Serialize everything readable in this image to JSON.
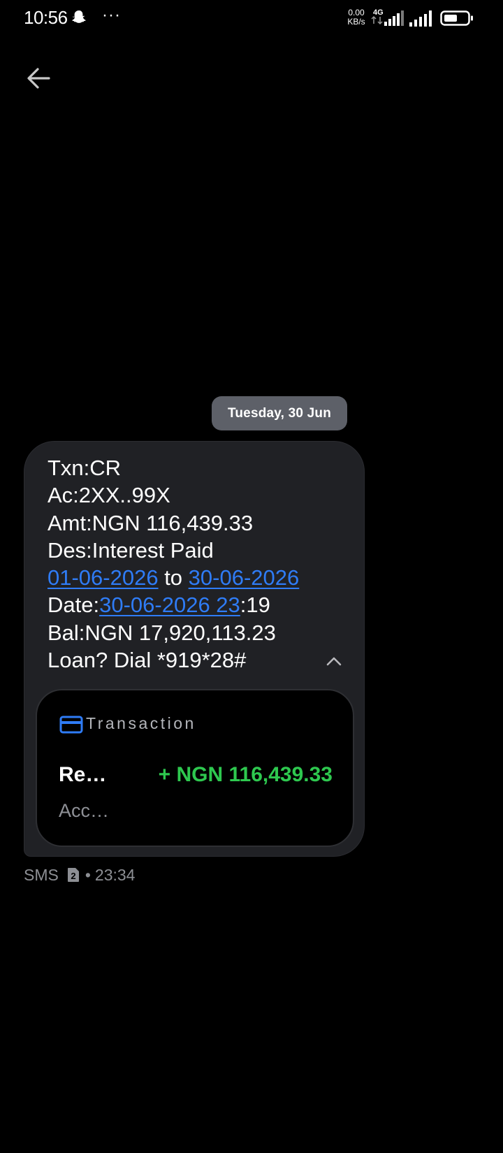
{
  "status_bar": {
    "time": "10:56",
    "more": "···",
    "net_speed_value": "0.00",
    "net_speed_unit": "KB/s",
    "network_type": "4G",
    "icons": [
      "snapchat-ghost-icon",
      "more-dots-icon",
      "signal-4g-icon",
      "signal-icon",
      "battery-icon"
    ]
  },
  "toolbar": {
    "back_icon": "arrow-left-icon"
  },
  "conversation": {
    "date_header": "Tuesday, 30 Jun",
    "message": {
      "line1": "Txn:CR",
      "line2": "Ac:2XX..99X",
      "line3": "Amt:NGN 116,439.33",
      "line4": "Des:Interest Paid",
      "line5_link1": "01-06-2026",
      "line5_mid": " to ",
      "line5_link2": "30-06-2026",
      "line6_prefix": "Date:",
      "line6_link": "30-06-2026 23",
      "line6_suffix": ":19",
      "line7": "Bal:NGN 17,920,113.23",
      "line8": "Loan? Dial *919*28#"
    },
    "transaction_card": {
      "title": "Transaction",
      "label": "Re…",
      "amount": "+ NGN 116,439.33",
      "sub": "Acc…",
      "amount_color": "#2ec84f",
      "icon": "credit-card-icon"
    },
    "meta": {
      "channel": "SMS",
      "sim_slot": "2",
      "separator": "•",
      "time": "23:34"
    }
  },
  "colors": {
    "background": "#000000",
    "bubble": "#202125",
    "date_chip": "#5d6068",
    "link": "#2f7cf6",
    "accent_icon": "#2f7cf6"
  }
}
